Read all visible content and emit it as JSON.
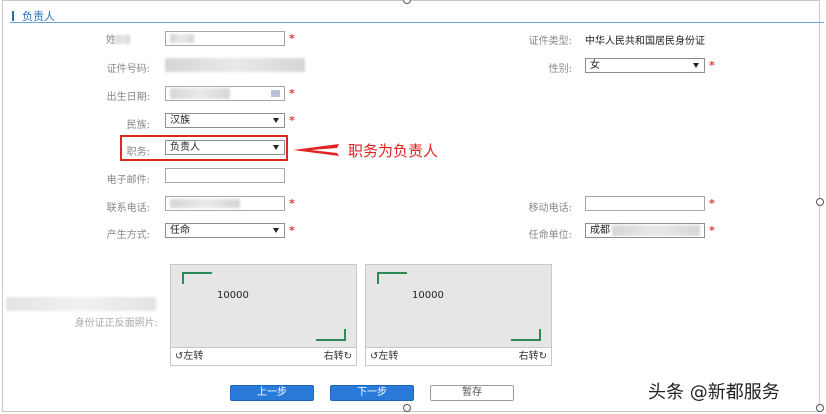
{
  "section": {
    "title": "负责人"
  },
  "labels": {
    "name": "姓",
    "id_type": "证件类型:",
    "id_number": "证件号码:",
    "gender": "性别:",
    "birth_date": "出生日期:",
    "ethnicity": "民族:",
    "position": "职务:",
    "email": "电子邮件:",
    "phone": "联系电话:",
    "mobile": "移动电话:",
    "method": "产生方式:",
    "unit": "任命单位:",
    "id_photos": "身份证正反面照片:"
  },
  "values": {
    "id_type": "中华人民共和国居民身份证",
    "gender": "女",
    "ethnicity": "汉族",
    "position": "负责人",
    "method": "任命",
    "unit": "成都"
  },
  "required_mark": "*",
  "annotation": "职务为负责人",
  "uploaders": [
    {
      "placeholder": "10000",
      "rotate_left": "左转",
      "rotate_right": "右转"
    },
    {
      "placeholder": "10000",
      "rotate_left": "左转",
      "rotate_right": "右转"
    }
  ],
  "buttons": {
    "prev": "上一步",
    "next": "下一步",
    "save": "暂存"
  },
  "watermark": "头条 @新都服务",
  "colors": {
    "accent": "#2a7ad9",
    "required": "#e23b3b",
    "annotation": "#e02323"
  }
}
